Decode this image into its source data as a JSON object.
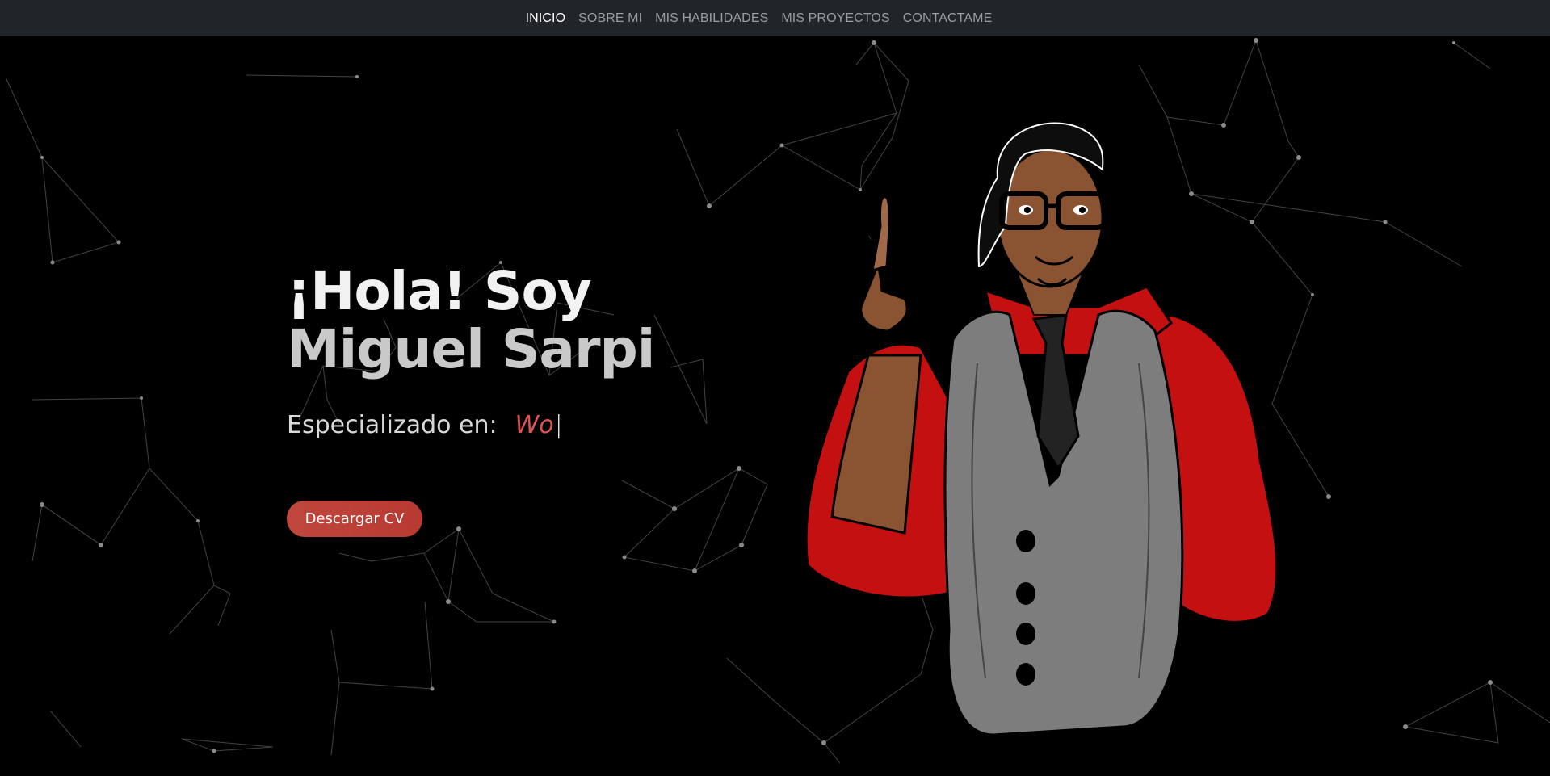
{
  "nav": {
    "items": [
      {
        "label": "INICIO",
        "active": true
      },
      {
        "label": "SOBRE MI",
        "active": false
      },
      {
        "label": "MIS HABILIDADES",
        "active": false
      },
      {
        "label": "MIS PROYECTOS",
        "active": false
      },
      {
        "label": "CONTACTAME",
        "active": false
      }
    ]
  },
  "hero": {
    "greeting": "¡Hola! Soy",
    "name": "Miguel Sarpi",
    "specialty_label": "Especializado en:",
    "specialty_typed": "Wo",
    "cursor": "|",
    "cv_button": "Descargar CV"
  },
  "colors": {
    "navbar_bg": "#212529",
    "page_bg": "#000000",
    "accent": "#e05252",
    "button": "#c0473d"
  }
}
